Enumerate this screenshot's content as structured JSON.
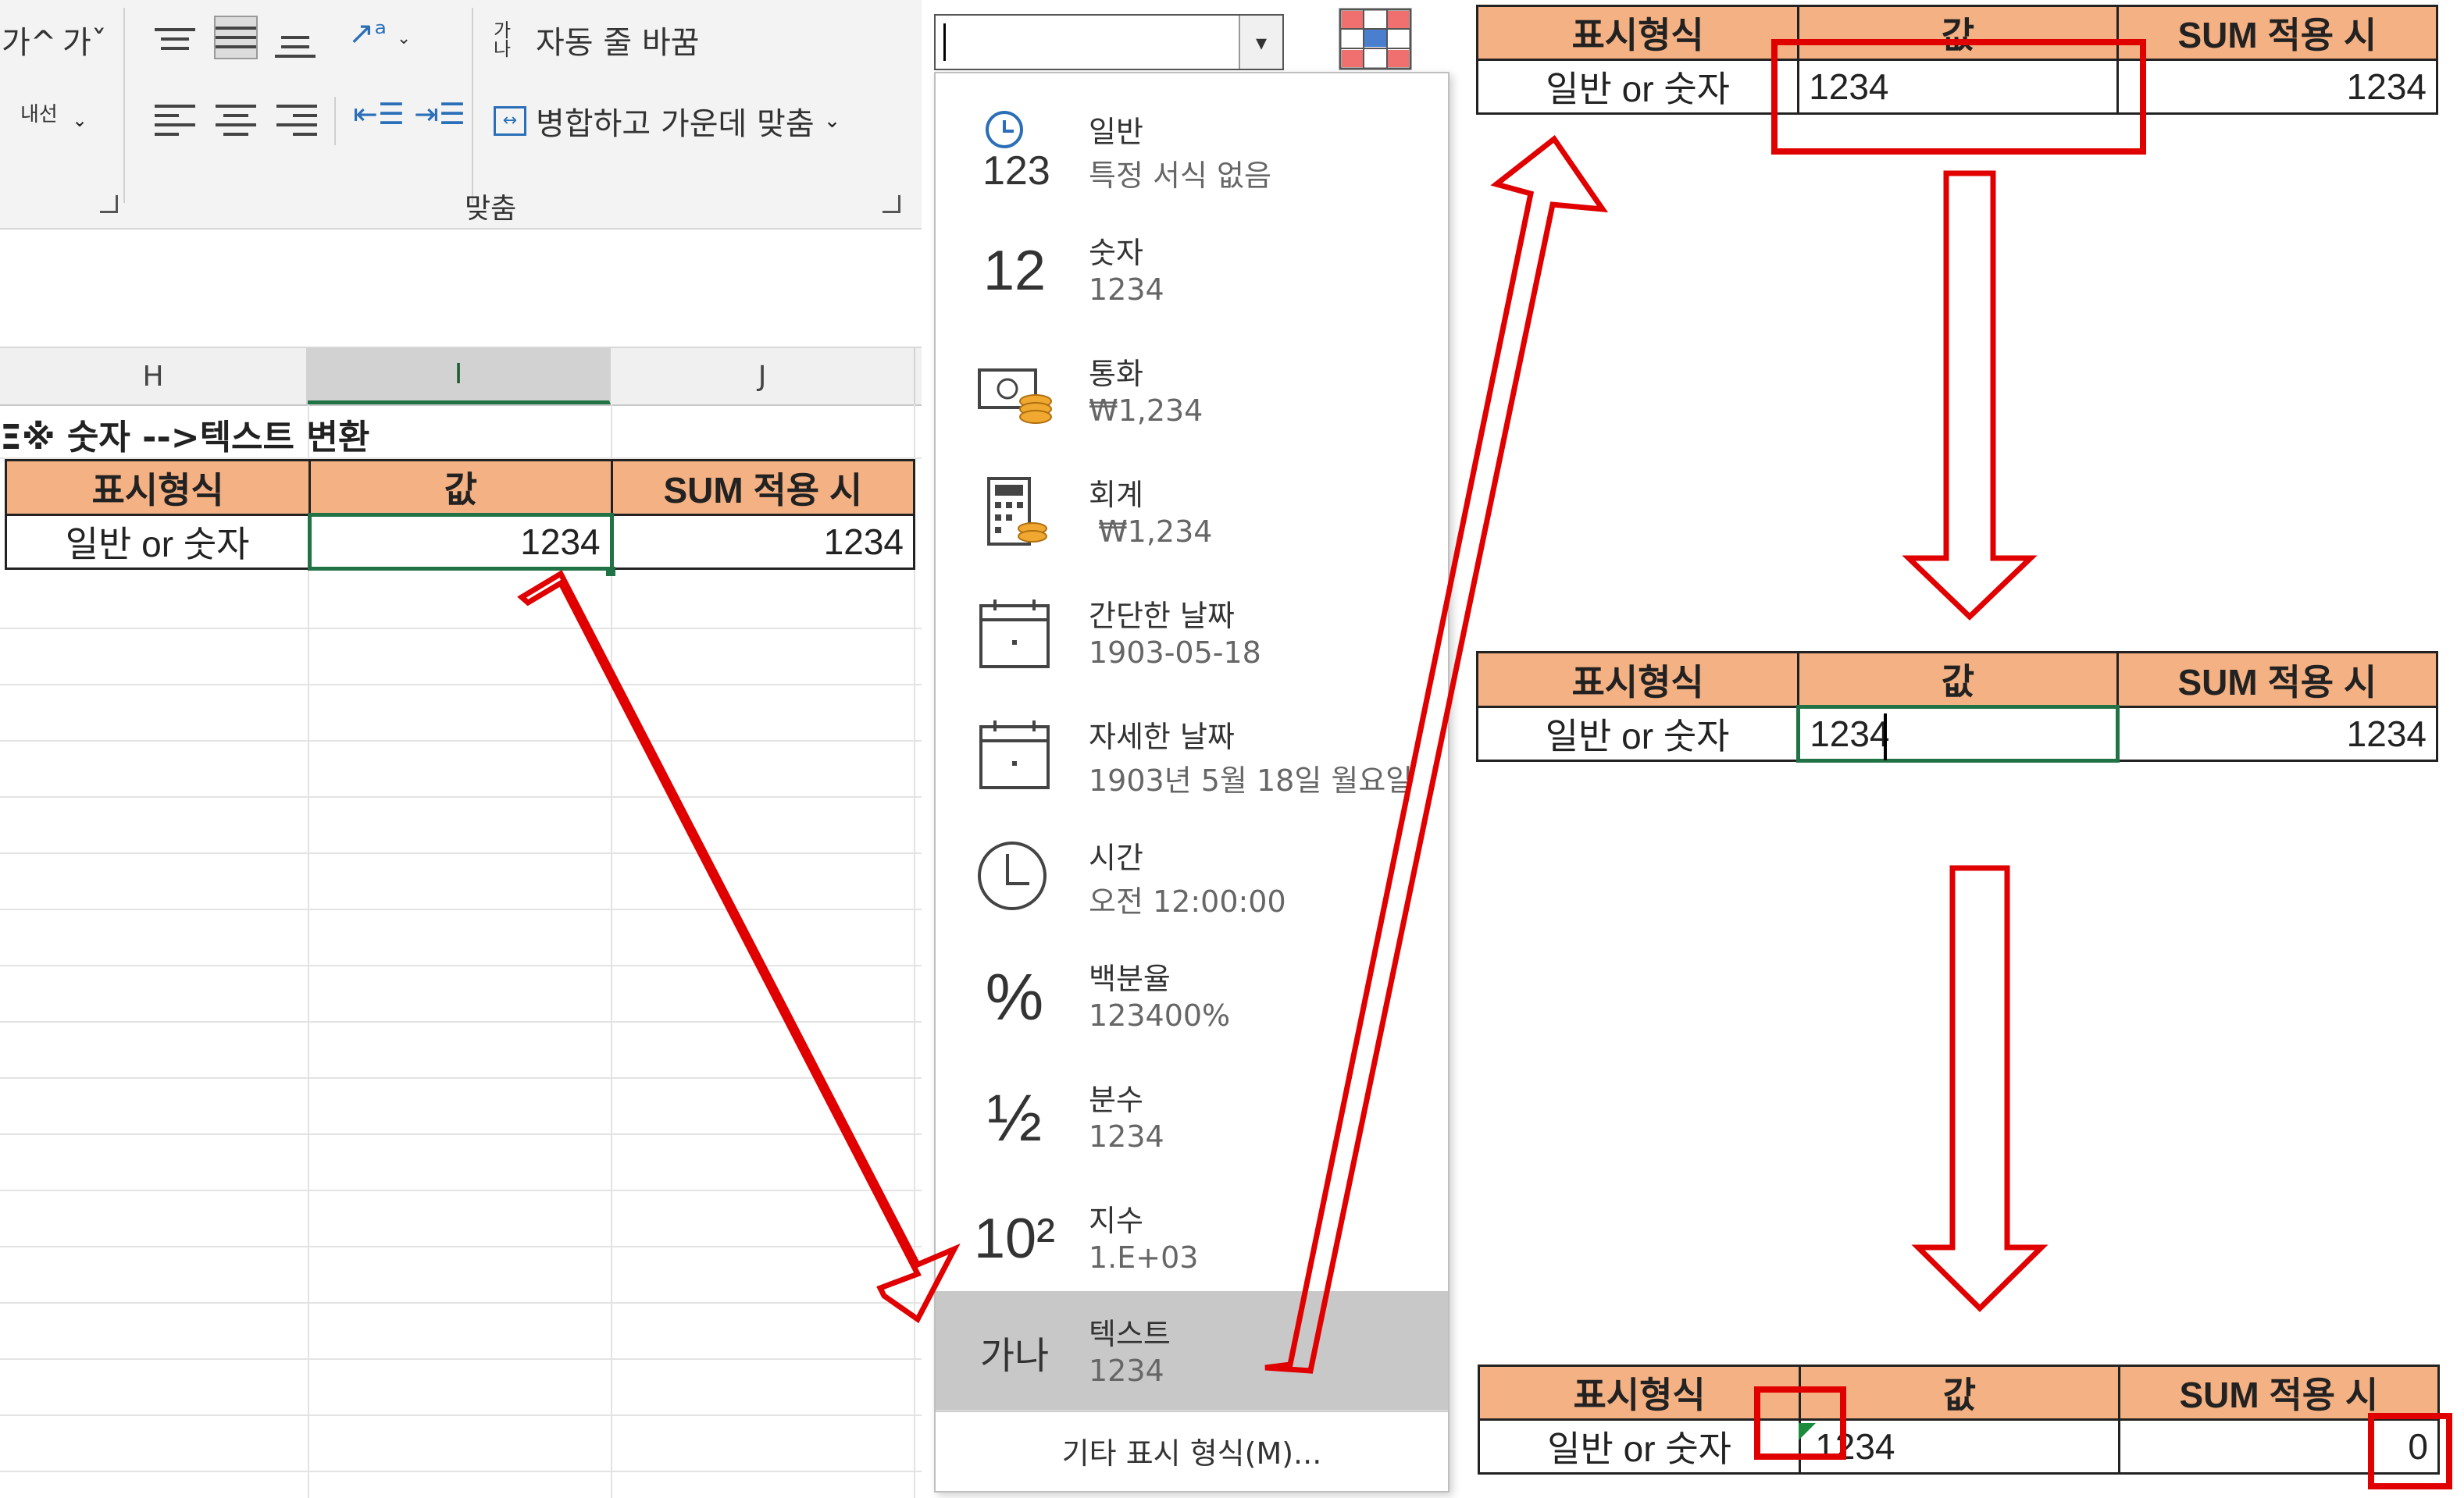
{
  "ribbon": {
    "font_grow": "가^",
    "font_shrink": "가ˇ",
    "indent_label": "내선",
    "wrap_text": "자동 줄 바꿈",
    "merge_center": "병합하고 가운데 맞춤",
    "group_label": "맞춤",
    "wrap_icon_text": "가나"
  },
  "number_format_box": {
    "value": ""
  },
  "sheet": {
    "columns": [
      "H",
      "I",
      "J"
    ],
    "title": "※ 숫자 -->텍스트 변환",
    "title_prefix": "Ξ",
    "headers": [
      "표시형식",
      "값",
      "SUM 적용 시"
    ],
    "row": [
      "일반 or 숫자",
      "1234",
      "1234"
    ]
  },
  "dropdown": {
    "items": [
      {
        "icon": "clock-123-icon",
        "icon_text": "123",
        "name": "일반",
        "sample": "특정 서식 없음"
      },
      {
        "icon": "number-12-icon",
        "icon_text": "12",
        "name": "숫자",
        "sample": "1234"
      },
      {
        "icon": "currency-icon",
        "icon_text": "",
        "name": "통화",
        "sample": "₩1,234"
      },
      {
        "icon": "calculator-icon",
        "icon_text": "",
        "name": "회계",
        "sample": " ₩1,234"
      },
      {
        "icon": "calendar-icon",
        "icon_text": "",
        "name": "간단한 날짜",
        "sample": "1903-05-18"
      },
      {
        "icon": "calendar-long-icon",
        "icon_text": "",
        "name": "자세한 날짜",
        "sample": "1903년 5월 18일 월요일"
      },
      {
        "icon": "clock-icon",
        "icon_text": "",
        "name": "시간",
        "sample": "오전 12:00:00"
      },
      {
        "icon": "percent-icon",
        "icon_text": "%",
        "name": "백분율",
        "sample": "123400%"
      },
      {
        "icon": "fraction-icon",
        "icon_text": "½",
        "name": "분수",
        "sample": "1234"
      },
      {
        "icon": "exponent-icon",
        "icon_text": "10²",
        "name": "지수",
        "sample": "1.E+03"
      },
      {
        "icon": "text-ga-na-icon",
        "icon_text": "가나",
        "name": "텍스트",
        "sample": "1234"
      }
    ],
    "selected_index": 10,
    "more_formats": "기타 표시 형식(M)..."
  },
  "steps": [
    {
      "headers": [
        "표시형식",
        "값",
        "SUM 적용 시"
      ],
      "row": [
        "일반 or 숫자",
        "1234",
        "1234"
      ]
    },
    {
      "headers": [
        "표시형식",
        "값",
        "SUM 적용 시"
      ],
      "row": [
        "일반 or 숫자",
        "1234",
        "1234"
      ]
    },
    {
      "headers": [
        "표시형식",
        "값",
        "SUM 적용 시"
      ],
      "row": [
        "일반 or 숫자",
        "1234",
        "0"
      ]
    }
  ],
  "colors": {
    "header_fill": "#f4b183",
    "annotation_red": "#e00000",
    "selection_green": "#217346",
    "dropdown_selected": "#c8c8c8"
  }
}
